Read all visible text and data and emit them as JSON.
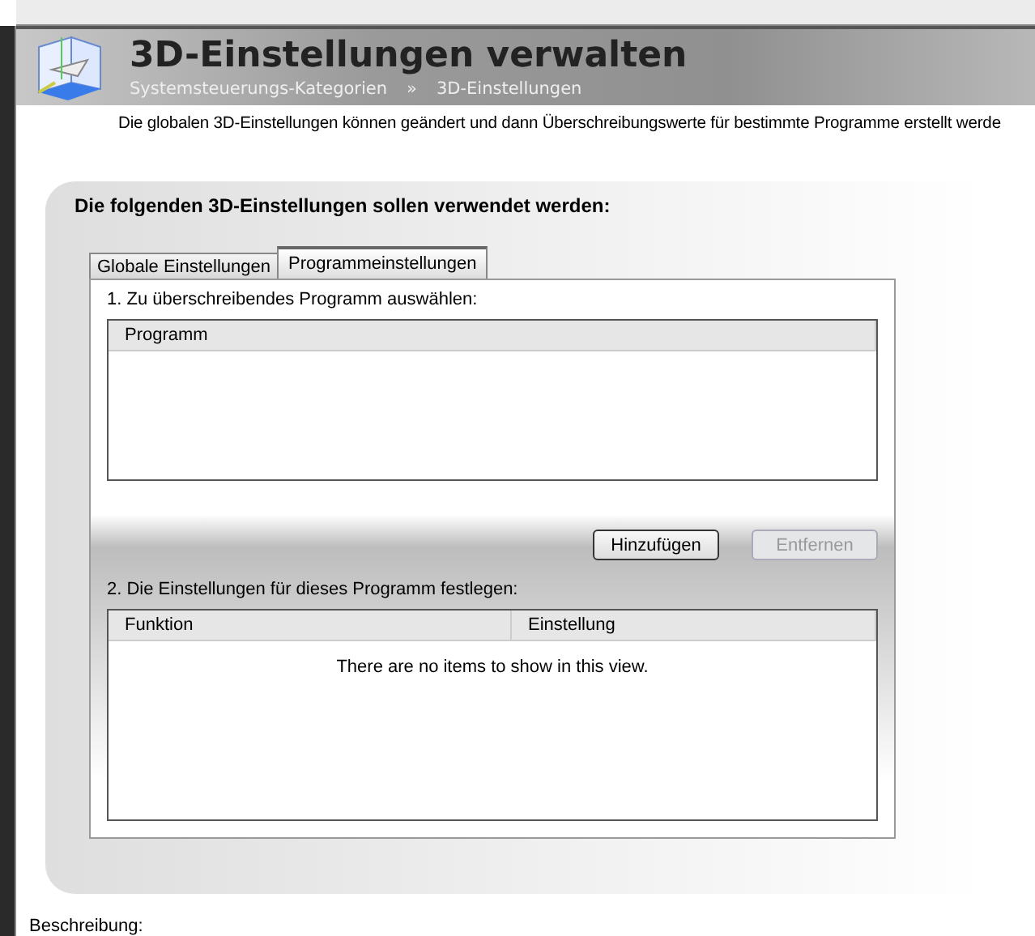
{
  "header": {
    "title": "3D-Einstellungen verwalten",
    "breadcrumb": [
      "Systemsteuerungs-Kategorien",
      "3D-Einstellungen"
    ],
    "separator": "»"
  },
  "intro": "Die globalen 3D-Einstellungen können geändert und dann Überschreibungswerte für bestimmte Programme erstellt werde",
  "panel": {
    "heading": "Die folgenden 3D-Einstellungen sollen verwendet werden:",
    "tabs": [
      {
        "label": "Globale Einstellungen",
        "selected": false
      },
      {
        "label": "Programmeinstellungen",
        "selected": true
      }
    ],
    "step1": "1. Zu überschreibendes Programm auswählen:",
    "program_list": {
      "columns": [
        "Programm"
      ]
    },
    "buttons": [
      {
        "label": "Hinzufügen",
        "disabled": false
      },
      {
        "label": "Entfernen",
        "disabled": true
      }
    ],
    "step2": "2. Die Einstellungen für dieses Programm festlegen:",
    "settings_list": {
      "columns": [
        "Funktion",
        "Einstellung"
      ],
      "empty_text": "There are no items to show in this view."
    }
  },
  "footer_label": "Beschreibung:"
}
